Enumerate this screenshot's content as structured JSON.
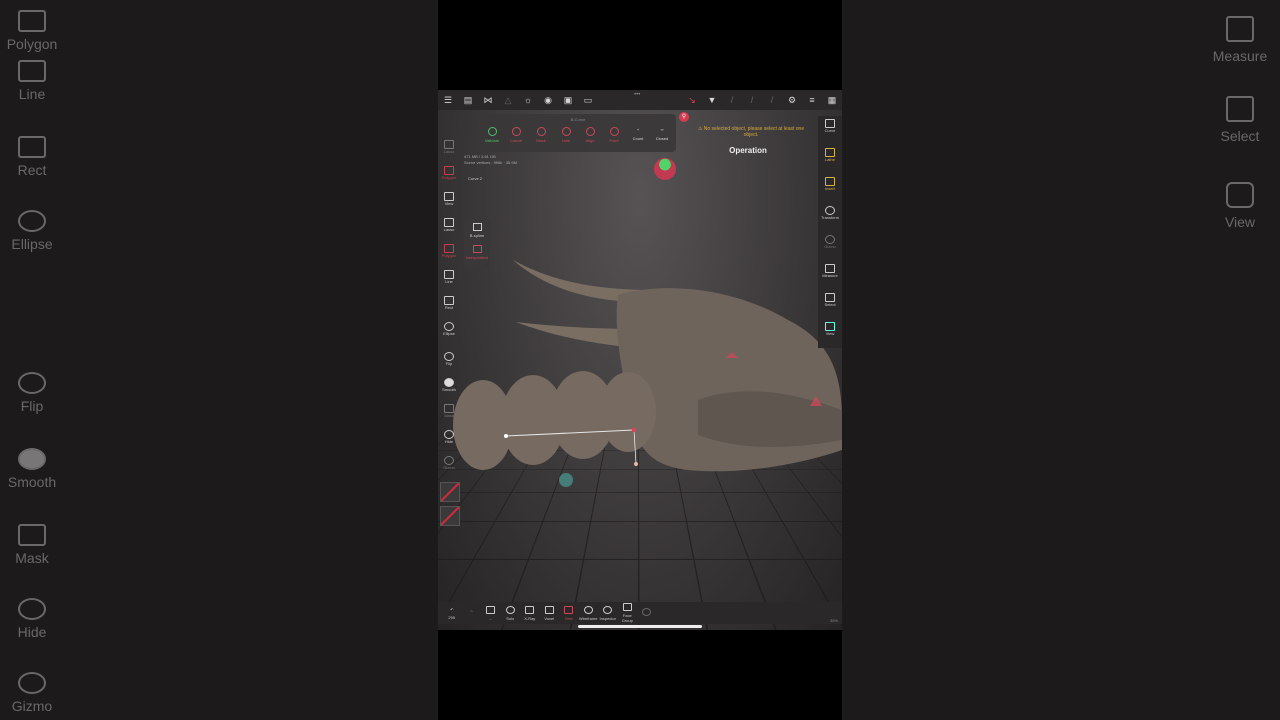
{
  "background_left": {
    "tools": [
      {
        "label": "Polygon",
        "icon": "polygon-icon"
      },
      {
        "label": "Line",
        "icon": "line-icon"
      },
      {
        "label": "Rect",
        "icon": "rect-icon"
      },
      {
        "label": "Ellipse",
        "icon": "ellipse-icon"
      },
      {
        "label": "Flip",
        "icon": "flip-icon"
      },
      {
        "label": "Smooth",
        "icon": "smooth-icon"
      },
      {
        "label": "Mask",
        "icon": "mask-icon"
      },
      {
        "label": "Hide",
        "icon": "hide-icon"
      },
      {
        "label": "Gizmo",
        "icon": "gizmo-icon"
      }
    ]
  },
  "background_right": {
    "tools": [
      {
        "label": "Measure",
        "icon": "ruler-icon"
      },
      {
        "label": "Select",
        "icon": "select-icon"
      },
      {
        "label": "View",
        "icon": "camera-icon"
      }
    ]
  },
  "curve_panel": {
    "title": "B-Curve",
    "buttons": [
      {
        "label": "Validate",
        "icon": "check-icon",
        "color": "green"
      },
      {
        "label": "Cancel",
        "icon": "cross-icon",
        "color": "red"
      },
      {
        "label": "Mask",
        "icon": "shield-icon",
        "color": "red"
      },
      {
        "label": "Hole",
        "icon": "hole-icon",
        "color": "red"
      },
      {
        "label": "Align",
        "icon": "align-icon",
        "color": "red"
      },
      {
        "label": "Point",
        "icon": "point-icon",
        "color": "red"
      },
      {
        "label": "Count",
        "icon": "plus-icon",
        "color": "white"
      },
      {
        "label": "Closed",
        "icon": "infinity-icon",
        "color": "white"
      }
    ]
  },
  "warning": "No selected object, please select at least one object.",
  "operation_title": "Operation",
  "info": {
    "line1": "471 MB / 3.61 GB",
    "line2": "Scene vertices : 996k · 35.9M",
    "curve_label": "Curve 2"
  },
  "sub_panel": [
    {
      "label": "B-spline",
      "icon": "spline-icon"
    },
    {
      "label": "Interpolation",
      "icon": "interp-icon"
    }
  ],
  "left_tools": [
    {
      "label": "Lasso",
      "color": "dim"
    },
    {
      "label": "Polygon",
      "color": "red"
    },
    {
      "label": "View",
      "color": "white"
    },
    {
      "label": "Lasso",
      "color": "white"
    },
    {
      "label": "Polygon",
      "color": "red"
    },
    {
      "label": "Line",
      "color": "white"
    },
    {
      "label": "Rect",
      "color": "white"
    },
    {
      "label": "Ellipse",
      "color": "white"
    },
    {
      "label": "Flip",
      "color": "white"
    },
    {
      "label": "Smooth",
      "color": "white"
    },
    {
      "label": "Mask",
      "color": "dim"
    },
    {
      "label": "Hide",
      "color": "white"
    },
    {
      "label": "Gizmo",
      "color": "dim"
    }
  ],
  "right_tools": [
    {
      "label": "Curve",
      "color": "white"
    },
    {
      "label": "Lathe",
      "color": "gold"
    },
    {
      "label": "Insert",
      "color": "gold"
    },
    {
      "label": "Transform",
      "color": "white"
    },
    {
      "label": "Gizmo",
      "color": "dim"
    },
    {
      "label": "Measure",
      "color": "white"
    },
    {
      "label": "Select",
      "color": "white"
    },
    {
      "label": "View",
      "color": "cyan"
    }
  ],
  "bottom_bar": [
    {
      "label": "295",
      "icon": "undo-icon",
      "color": "white"
    },
    {
      "label": "",
      "icon": "redo-icon",
      "color": "dim"
    },
    {
      "label": "...",
      "icon": "trash-icon",
      "color": "white"
    },
    {
      "label": "Solo",
      "icon": "search-icon",
      "color": "white"
    },
    {
      "label": "X-Ray",
      "icon": "xray-icon",
      "color": "white"
    },
    {
      "label": "Voxel",
      "icon": "voxel-icon",
      "color": "white"
    },
    {
      "label": "Grid",
      "icon": "grid-icon",
      "color": "red"
    },
    {
      "label": "Wireframe",
      "icon": "wireframe-icon",
      "color": "white"
    },
    {
      "label": "Inspector",
      "icon": "inspector-icon",
      "color": "white"
    },
    {
      "label": "Face Group",
      "icon": "facegroup-icon",
      "color": "white"
    },
    {
      "label": "",
      "icon": "info-icon",
      "color": "dim"
    }
  ],
  "zoom_label": "35%",
  "colors": {
    "accent": "#d23c50",
    "warning": "#d4a93a",
    "validate": "#4cc06a"
  }
}
